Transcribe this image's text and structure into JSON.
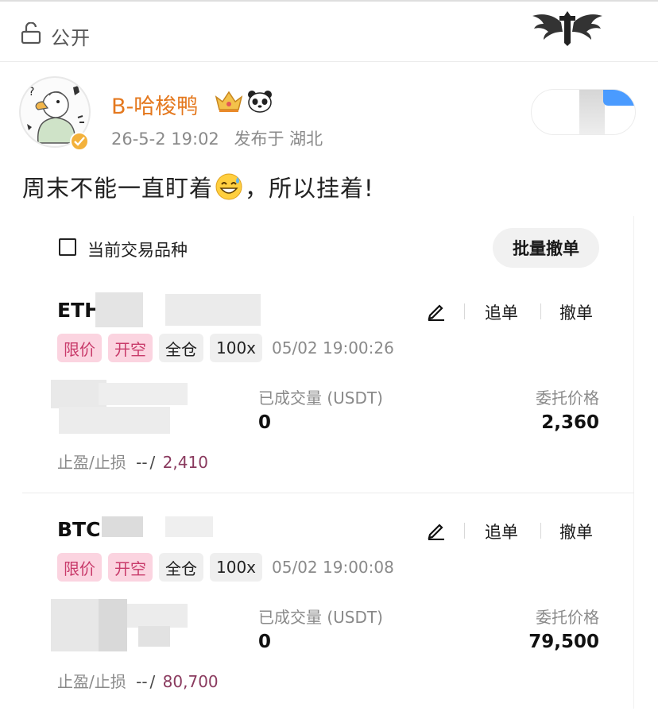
{
  "header": {
    "visibility_label": "公开",
    "icons": {
      "lock": "lock-open-icon",
      "logo": "wings-cross-logo"
    }
  },
  "post": {
    "author": "B-哈梭鸭",
    "author_color": "#e4781e",
    "badges": [
      "crown-badge",
      "panda-icon"
    ],
    "date": "26-5-2 19:02",
    "location": "发布于 湖北",
    "text_before": "周末不能一直盯着",
    "text_after": "，所以挂着!",
    "emoji": "sweat-smile-emoji"
  },
  "orders_panel": {
    "filter_label": "当前交易品种",
    "filter_checked": false,
    "batch_cancel_label": "批量撤单",
    "orders": [
      {
        "symbol": "ETH",
        "tags": [
          "限价",
          "开空",
          "全仓",
          "100x"
        ],
        "time": "05/02 19:00:26",
        "filled_label": "已成交量 (USDT)",
        "filled_value": "0",
        "price_label": "委托价格",
        "price_value": "2,360",
        "tpsl_label": "止盈/止损",
        "tp": "--",
        "sl": "2,410",
        "actions": {
          "chase": "追单",
          "cancel": "撤单"
        }
      },
      {
        "symbol": "BTC",
        "tags": [
          "限价",
          "开空",
          "全仓",
          "100x"
        ],
        "time": "05/02 19:00:08",
        "filled_label": "已成交量 (USDT)",
        "filled_value": "0",
        "price_label": "委托价格",
        "price_value": "79,500",
        "tpsl_label": "止盈/止损",
        "tp": "--",
        "sl": "80,700",
        "actions": {
          "chase": "追单",
          "cancel": "撤单"
        }
      }
    ]
  },
  "colors": {
    "tag_pink_bg": "#fbd4e0",
    "tag_pink_text": "#c83a6a",
    "stop_loss": "#8a3a5e"
  }
}
